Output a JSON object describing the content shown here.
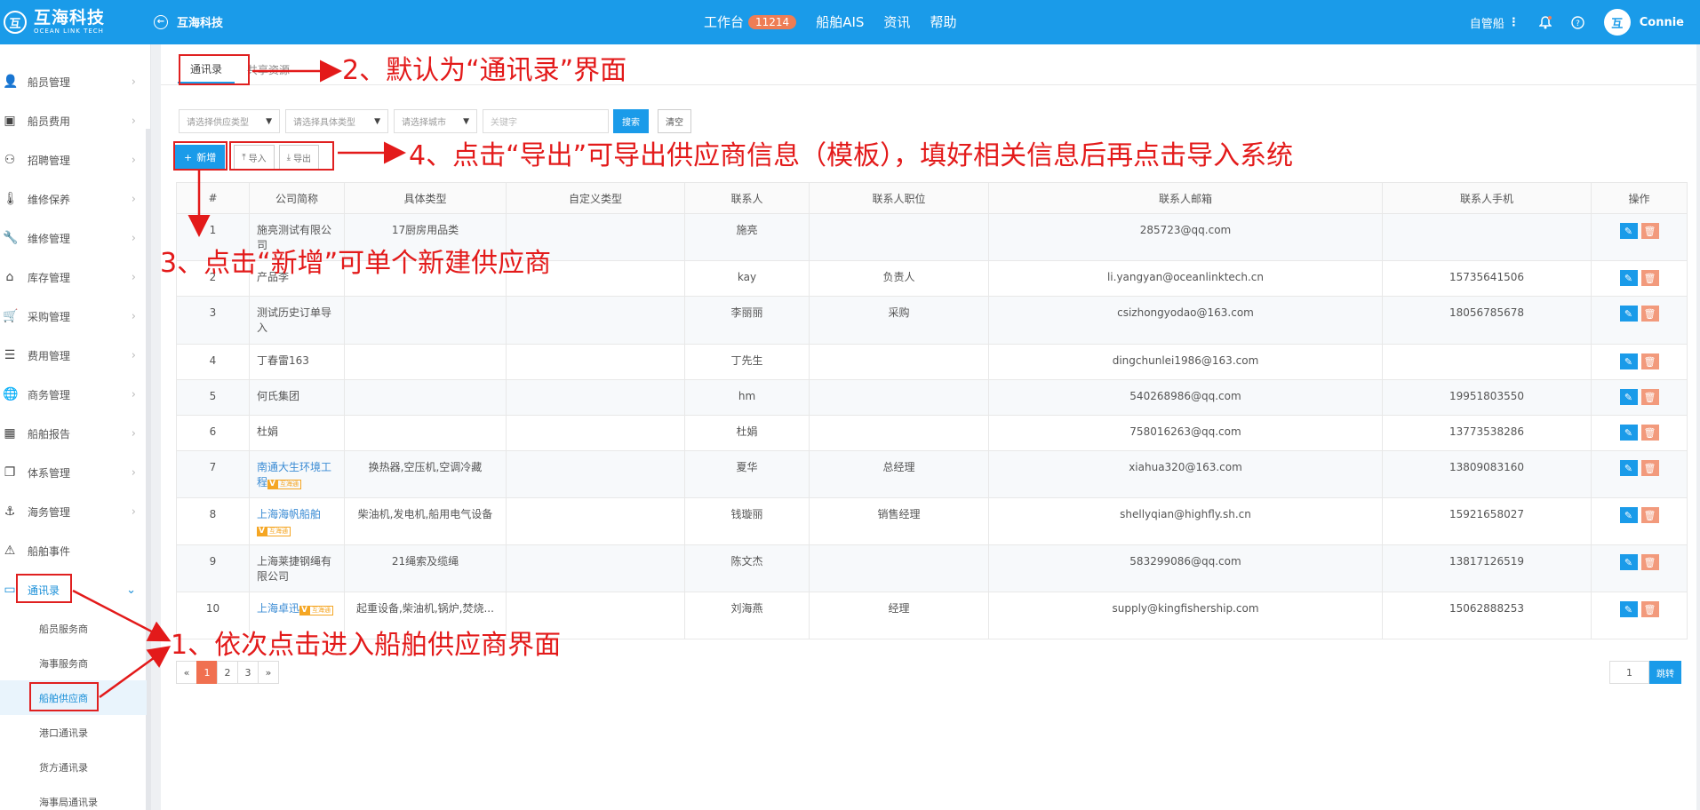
{
  "header": {
    "logo_mark": "互",
    "logo_cn": "互海科技",
    "logo_en": "OCEAN LINK TECH",
    "back_label": "互海科技",
    "nav": [
      {
        "label": "工作台",
        "badge": "11214"
      },
      {
        "label": "船舶AIS"
      },
      {
        "label": "资讯"
      },
      {
        "label": "帮助"
      }
    ],
    "ship_selector": "自管船",
    "user_name": "Connie"
  },
  "sidebar": {
    "items": [
      {
        "label": "船员管理",
        "icon": "person-icon"
      },
      {
        "label": "船员费用",
        "icon": "wallet-icon"
      },
      {
        "label": "招聘管理",
        "icon": "recruit-icon"
      },
      {
        "label": "维修保养",
        "icon": "thermometer-icon"
      },
      {
        "label": "维修管理",
        "icon": "wrench-icon"
      },
      {
        "label": "库存管理",
        "icon": "warehouse-icon"
      },
      {
        "label": "采购管理",
        "icon": "cart-icon"
      },
      {
        "label": "费用管理",
        "icon": "coins-icon"
      },
      {
        "label": "商务管理",
        "icon": "globe-icon"
      },
      {
        "label": "船舶报告",
        "icon": "calendar-icon"
      },
      {
        "label": "体系管理",
        "icon": "document-icon"
      },
      {
        "label": "海务管理",
        "icon": "anchor-icon"
      },
      {
        "label": "船舶事件",
        "icon": "warning-icon"
      },
      {
        "label": "通讯录",
        "icon": "contacts-icon"
      }
    ],
    "sub_items": [
      {
        "label": "船员服务商"
      },
      {
        "label": "海事服务商"
      },
      {
        "label": "船舶供应商"
      },
      {
        "label": "港口通讯录"
      },
      {
        "label": "货方通讯录"
      },
      {
        "label": "海事局通讯录"
      }
    ]
  },
  "tabs": [
    {
      "label": "通讯录"
    },
    {
      "label": "共享资源"
    }
  ],
  "filters": {
    "supply_type": "请选择供应类型",
    "specific_type": "请选择具体类型",
    "city": "请选择城市",
    "keyword_placeholder": "关键字",
    "search_label": "搜索",
    "clear_label": "清空"
  },
  "toolbar": {
    "add_label": "新增",
    "import_label": "导入",
    "export_label": "导出"
  },
  "table": {
    "columns": [
      "#",
      "公司简称",
      "具体类型",
      "自定义类型",
      "联系人",
      "联系人职位",
      "联系人邮箱",
      "联系人手机",
      "操作"
    ],
    "rows": [
      {
        "no": "1",
        "company": "施亮测试有限公司",
        "type": "17厨房用品类",
        "custom": "",
        "contact": "施亮",
        "position": "",
        "email": "285723@qq.com",
        "phone": "",
        "tag": ""
      },
      {
        "no": "2",
        "company": "产品李",
        "type": "",
        "custom": "",
        "contact": "kay",
        "position": "负责人",
        "email": "li.yangyan@oceanlinktech.cn",
        "phone": "15735641506",
        "tag": ""
      },
      {
        "no": "3",
        "company": "测试历史订单导入",
        "type": "",
        "custom": "",
        "contact": "李丽丽",
        "position": "采购",
        "email": "csizhongyodao@163.com",
        "phone": "18056785678",
        "tag": ""
      },
      {
        "no": "4",
        "company": "丁春雷163",
        "type": "",
        "custom": "",
        "contact": "丁先生",
        "position": "",
        "email": "dingchunlei1986@163.com",
        "phone": "",
        "tag": ""
      },
      {
        "no": "5",
        "company": "何氏集团",
        "type": "",
        "custom": "",
        "contact": "hm",
        "position": "",
        "email": "540268986@qq.com",
        "phone": "19951803550",
        "tag": ""
      },
      {
        "no": "6",
        "company": "杜娟",
        "type": "",
        "custom": "",
        "contact": "杜娟",
        "position": "",
        "email": "758016263@qq.com",
        "phone": "13773538286",
        "tag": ""
      },
      {
        "no": "7",
        "company": "南通大生环境工程",
        "type": "换热器,空压机,空调冷藏",
        "custom": "",
        "contact": "夏华",
        "position": "总经理",
        "email": "xiahua320@163.com",
        "phone": "13809083160",
        "tag": "互海通"
      },
      {
        "no": "8",
        "company": "上海海帆船舶",
        "type": "柴油机,发电机,船用电气设备",
        "custom": "",
        "contact": "钱璇丽",
        "position": "销售经理",
        "email": "shellyqian@highfly.sh.cn",
        "phone": "15921658027",
        "tag": "互海通"
      },
      {
        "no": "9",
        "company": "上海莱捷钢绳有限公司",
        "type": "21绳索及缆绳",
        "custom": "",
        "contact": "陈文杰",
        "position": "",
        "email": "583299086@qq.com",
        "phone": "13817126519",
        "tag": ""
      },
      {
        "no": "10",
        "company": "上海卓迅",
        "type": "起重设备,柴油机,锅炉,焚烧...",
        "custom": "",
        "contact": "刘海燕",
        "position": "经理",
        "email": "supply@kingfishership.com",
        "phone": "15062888253",
        "tag": "互海通"
      }
    ]
  },
  "pagination": {
    "prev": "«",
    "pages": [
      "1",
      "2",
      "3"
    ],
    "current": "1",
    "next": "»",
    "jump_value": "1",
    "jump_label": "跳转"
  },
  "annotations": {
    "step1": "1、依次点击进入船舶供应商界面",
    "step2": "2、默认为“通讯录”界面",
    "step3": "3、点击“新增”可单个新建供应商",
    "step4": "4、点击“导出”可导出供应商信息（模板），填好相关信息后再点击导入系统",
    "color": "#e31a1a"
  },
  "colors": {
    "primary": "#1a9be9",
    "badge": "#ee7d55",
    "delete": "#f29a7c",
    "page_active": "#f07050"
  }
}
